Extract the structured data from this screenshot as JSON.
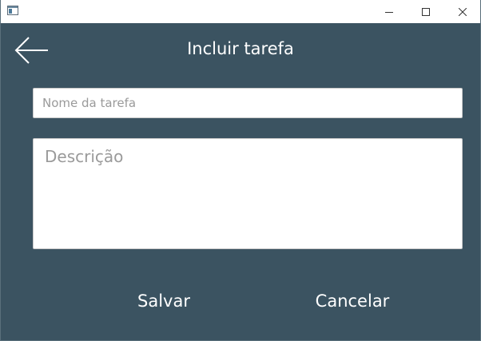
{
  "window": {
    "title": "",
    "controls": {
      "minimize_icon": "minimize-icon",
      "maximize_icon": "maximize-icon",
      "close_icon": "close-icon"
    }
  },
  "header": {
    "back_icon": "arrow-left-icon",
    "title": "Incluir tarefa"
  },
  "form": {
    "name_placeholder": "Nome da tarefa",
    "name_value": "",
    "description_placeholder": "Descrição",
    "description_value": ""
  },
  "actions": {
    "save_label": "Salvar",
    "cancel_label": "Cancelar"
  },
  "colors": {
    "background": "#3b5361",
    "titlebar": "#ffffff",
    "text": "#ffffff",
    "placeholder": "#9a9a9a"
  }
}
